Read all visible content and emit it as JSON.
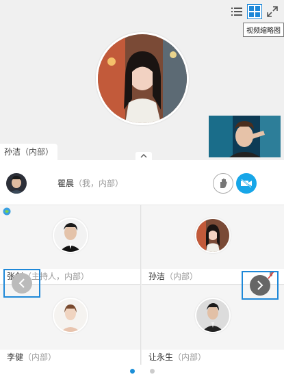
{
  "toolbar": {
    "list_view_icon": "list-icon",
    "grid_view_icon": "grid-icon",
    "fullscreen_icon": "expand-icon",
    "tooltip": "视频缩略图"
  },
  "main_video": {
    "speaker_label": "孙洁",
    "speaker_role": "（内部）"
  },
  "self_row": {
    "name": "瞿晨",
    "role": "（我，内部）",
    "hand_icon": "raise-hand-icon",
    "camera_icon": "camera-off-icon"
  },
  "grid": {
    "participants": [
      {
        "name": "张剑",
        "role": "（主持人，内部）"
      },
      {
        "name": "孙洁",
        "role": "（内部）"
      },
      {
        "name": "李健",
        "role": "（内部）"
      },
      {
        "name": "让永生",
        "role": "（内部）"
      }
    ]
  },
  "pager": {
    "total": 2,
    "current": 1
  },
  "colors": {
    "accent": "#1e88d8",
    "camera_button": "#17a6e8"
  }
}
